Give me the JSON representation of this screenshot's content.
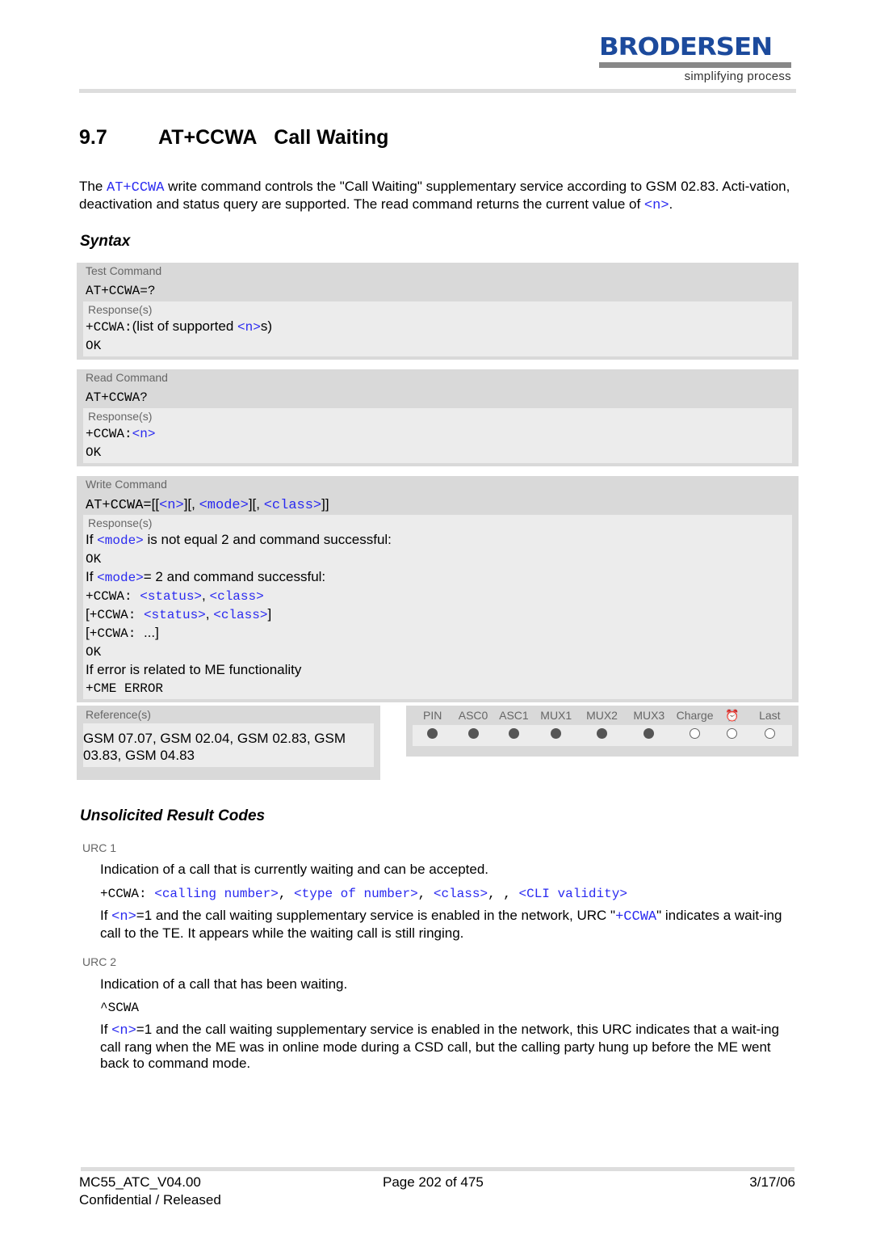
{
  "header": {
    "logo_text": "BRODERSEN",
    "logo_tagline": "simplifying process",
    "brand_color": "#1c4a9c"
  },
  "section": {
    "number": "9.7",
    "command": "AT+CCWA",
    "title": "Call Waiting"
  },
  "intro": [
    {
      "t": "The "
    },
    {
      "t": "AT+CCWA",
      "c": "lk"
    },
    {
      "t": " write command controls the \"Call Waiting\" supplementary service according to GSM 02.83. Acti-vation, deactivation and status query are supported. The read command returns the current value of "
    },
    {
      "t": "<n>",
      "c": "lk"
    },
    {
      "t": "."
    }
  ],
  "syntax": {
    "heading": "Syntax",
    "response_label": "Response(s)",
    "test": {
      "label": "Test Command",
      "command": "AT+CCWA=?",
      "lines": [
        [
          {
            "t": "+CCWA:",
            "c": "mono"
          },
          {
            "t": "(list of supported "
          },
          {
            "t": "<n>",
            "c": "lk"
          },
          {
            "t": "s)"
          }
        ],
        [
          {
            "t": "OK",
            "c": "mono"
          }
        ]
      ]
    },
    "read": {
      "label": "Read Command",
      "command": "AT+CCWA?",
      "lines": [
        [
          {
            "t": "+CCWA:",
            "c": "mono"
          },
          {
            "t": "<n>",
            "c": "lk"
          }
        ],
        [
          {
            "t": "OK",
            "c": "mono"
          }
        ]
      ]
    },
    "write": {
      "label": "Write Command",
      "command": [
        {
          "t": "AT+CCWA=",
          "c": "mono"
        },
        {
          "t": "[["
        },
        {
          "t": "<n>",
          "c": "lk"
        },
        {
          "t": "][, "
        },
        {
          "t": "<mode>",
          "c": "lk"
        },
        {
          "t": "][, "
        },
        {
          "t": "<class>",
          "c": "lk"
        },
        {
          "t": "]]"
        }
      ],
      "lines": [
        [
          {
            "t": "If "
          },
          {
            "t": "<mode>",
            "c": "lk"
          },
          {
            "t": " is not equal 2 and command successful:"
          }
        ],
        [
          {
            "t": "OK",
            "c": "mono"
          }
        ],
        [
          {
            "t": "If "
          },
          {
            "t": "<mode>",
            "c": "lk"
          },
          {
            "t": "= 2 and command successful:"
          }
        ],
        [
          {
            "t": "+CCWA: ",
            "c": "mono"
          },
          {
            "t": "<status>",
            "c": "lk"
          },
          {
            "t": ", "
          },
          {
            "t": "<class>",
            "c": "lk"
          }
        ],
        [
          {
            "t": "["
          },
          {
            "t": "+CCWA: ",
            "c": "mono"
          },
          {
            "t": "<status>",
            "c": "lk"
          },
          {
            "t": ", "
          },
          {
            "t": "<class>",
            "c": "lk"
          },
          {
            "t": "]"
          }
        ],
        [
          {
            "t": "["
          },
          {
            "t": "+CCWA: ",
            "c": "mono"
          },
          {
            "t": "...]"
          }
        ],
        [
          {
            "t": "OK",
            "c": "mono"
          }
        ],
        [
          {
            "t": "If error is related to ME functionality"
          }
        ],
        [
          {
            "t": "+CME ERROR",
            "c": "mono"
          }
        ]
      ]
    }
  },
  "references": {
    "label": "Reference(s)",
    "text": "GSM 07.07, GSM 02.04, GSM 02.83, GSM 03.83, GSM 04.83"
  },
  "support_table": {
    "columns": [
      "PIN",
      "ASC0",
      "ASC1",
      "MUX1",
      "MUX2",
      "MUX3",
      "Charge",
      "alarm-clock-icon",
      "Last"
    ],
    "supported": [
      true,
      true,
      true,
      true,
      true,
      true,
      false,
      false,
      false
    ]
  },
  "urc": {
    "heading": "Unsolicited Result Codes",
    "items": [
      {
        "label": "URC 1",
        "desc": "Indication of a call that is currently waiting and can be accepted.",
        "code": [
          {
            "t": "+CCWA: ",
            "c": "mono"
          },
          {
            "t": "<calling number>",
            "c": "lk"
          },
          {
            "t": ", ",
            "c": "mono"
          },
          {
            "t": "<type of number>",
            "c": "lk"
          },
          {
            "t": ", ",
            "c": "mono"
          },
          {
            "t": "<class>",
            "c": "lk"
          },
          {
            "t": ", , ",
            "c": "mono"
          },
          {
            "t": "<CLI validity>",
            "c": "lk"
          }
        ],
        "note": [
          {
            "t": "If "
          },
          {
            "t": "<n>",
            "c": "lk"
          },
          {
            "t": "=1 and the call waiting supplementary service is enabled in the network, URC \""
          },
          {
            "t": "+CCWA",
            "c": "lk"
          },
          {
            "t": "\" indicates a wait-ing call to the TE. It appears while the waiting call is still ringing."
          }
        ]
      },
      {
        "label": "URC 2",
        "desc": "Indication of a call that has been waiting.",
        "code": [
          {
            "t": "^SCWA",
            "c": "mono"
          }
        ],
        "note": [
          {
            "t": "If "
          },
          {
            "t": "<n>",
            "c": "lk"
          },
          {
            "t": "=1 and the call waiting supplementary service is enabled in the network, this URC indicates that a wait-ing call rang when the ME was in online mode during a CSD call, but the calling party hung up before the ME went back to command mode."
          }
        ]
      }
    ]
  },
  "footer": {
    "doc_id": "MC55_ATC_V04.00",
    "classification": "Confidential / Released",
    "page": "Page 202 of 475",
    "date": "3/17/06"
  }
}
